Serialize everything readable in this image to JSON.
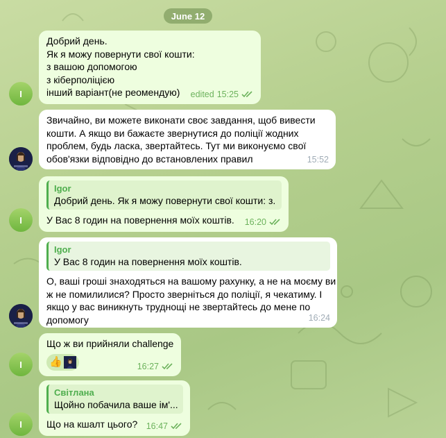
{
  "date_label": "June 12",
  "user_initial": "I",
  "messages": {
    "m1": {
      "lines": [
        "Добрий день.",
        "Як я можу повернути свої кошти:",
        "з вашою допомогою",
        "з кіберполіцією",
        "інший варіант(не реомендую)"
      ],
      "edited": "edited",
      "time": "15:25"
    },
    "m2": {
      "lines": [
        "Звичайно, ви можете виконати своє завдання, щоб вивести",
        "кошти. А якщо ви бажаєте звернутися до поліції жодних",
        "проблем, будь ласка, звертайтесь. Тут ми виконуємо свої",
        "обов'язки відповідно до встановлених правил"
      ],
      "time": "15:52"
    },
    "m3": {
      "reply_name": "Igor",
      "reply_text": "Добрий день. Як я можу повернути свої кошти: з...",
      "text": "У Вас  8 годин на повернення моїх коштів.",
      "time": "16:20"
    },
    "m4": {
      "reply_name": "Igor",
      "reply_text": "У Вас  8 годин на повернення моїх коштів.",
      "lines": [
        "О, ваші гроші знаходяться на вашому рахунку, а не на моєму ви",
        "ж не помилилися? Просто зверніться до поліції, я чекатиму. І",
        "якщо у вас виникнуть труднощі не звертайтесь до мене по",
        "допомогу"
      ],
      "time": "16:24"
    },
    "m5": {
      "text": "Що ж ви прийняли challenge",
      "reaction": "👍",
      "time": "16:27"
    },
    "m6": {
      "reply_name": "Світлана",
      "reply_text": "Щойно побачила ваше ім'...",
      "text": "Що на кшалт цього?",
      "time": "16:47"
    }
  },
  "colors": {
    "outgoing_bubble": "#eefedf",
    "incoming_bubble": "#ffffff",
    "accent_green": "#4fae4e",
    "check_green": "#6cb25c"
  },
  "icons": {
    "read_status": "double-check-icon",
    "reaction": "thumbs-up-emoji"
  }
}
